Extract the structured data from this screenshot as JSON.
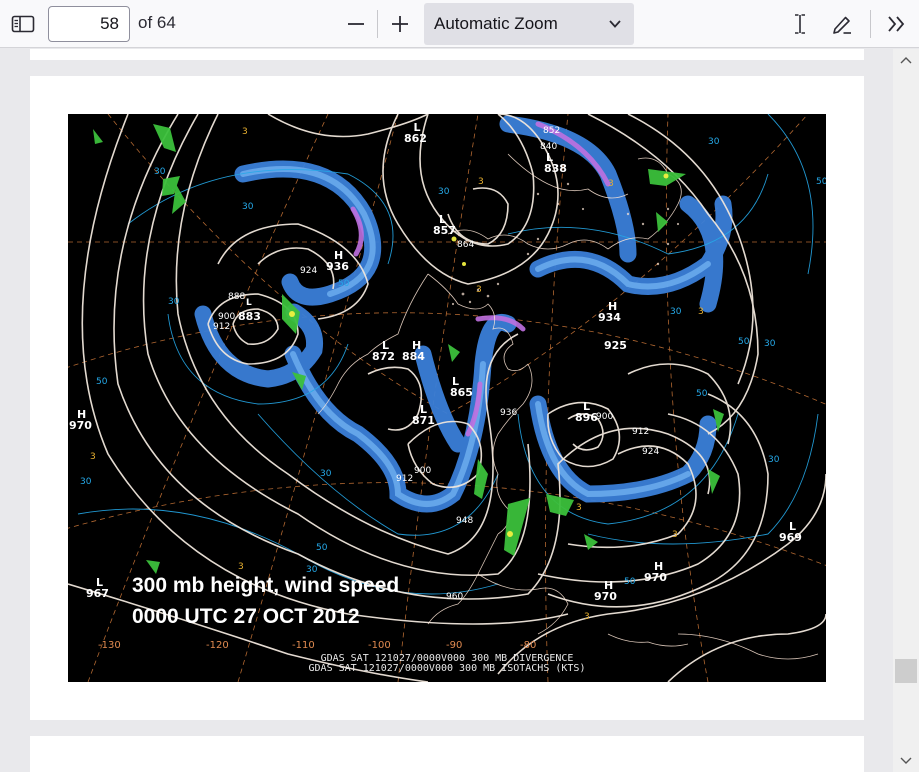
{
  "toolbar": {
    "page_number": "58",
    "page_count": "of 64",
    "zoom_label": "Automatic Zoom",
    "icons": [
      "sidebar-toggle-icon",
      "zoom-out-icon",
      "zoom-in-icon",
      "chevron-down-icon",
      "text-cursor-icon",
      "draw-pen-icon",
      "double-chevron-right-icon"
    ]
  },
  "figure": {
    "caption_line1": "300 mb height, wind speed",
    "caption_line2": "0000 UTC 27 OCT 2012",
    "footer_line1": "GDAS SAT 121027/0000V000 300 MB DIVERGENCE",
    "footer_line2": "GDAS SAT 121027/0000V000 300 MB ISOTACHS (KTS)",
    "longitudes": [
      "-130",
      "-120",
      "-110",
      "-100",
      "-90",
      "-80"
    ],
    "pressure_centers": [
      {
        "type": "L",
        "value": "862"
      },
      {
        "type": "L",
        "value": "852"
      },
      {
        "type": "L",
        "value": "840"
      },
      {
        "type": "L",
        "value": "838"
      },
      {
        "type": "L",
        "value": "857"
      },
      {
        "type": "",
        "value": "864"
      },
      {
        "type": "H",
        "value": "936"
      },
      {
        "type": "",
        "value": "924"
      },
      {
        "type": "L",
        "value": "888"
      },
      {
        "type": "",
        "value": "883"
      },
      {
        "type": "",
        "value": "900"
      },
      {
        "type": "",
        "value": "912"
      },
      {
        "type": "L",
        "value": "872"
      },
      {
        "type": "H",
        "value": "884"
      },
      {
        "type": "H",
        "value": "934"
      },
      {
        "type": "",
        "value": "925"
      },
      {
        "type": "L",
        "value": "865"
      },
      {
        "type": "L",
        "value": "871"
      },
      {
        "type": "H",
        "value": "970"
      },
      {
        "type": "L",
        "value": "896"
      },
      {
        "type": "",
        "value": "900"
      },
      {
        "type": "",
        "value": "912"
      },
      {
        "type": "",
        "value": "924"
      },
      {
        "type": "L",
        "value": "969"
      },
      {
        "type": "H",
        "value": "970"
      },
      {
        "type": "H",
        "value": "970"
      },
      {
        "type": "L",
        "value": "967"
      },
      {
        "type": "",
        "value": "960"
      },
      {
        "type": "",
        "value": "948"
      },
      {
        "type": "",
        "value": "936"
      },
      {
        "type": "",
        "value": "900"
      },
      {
        "type": "",
        "value": "912"
      }
    ],
    "isotach_labels": [
      "30",
      "50",
      "30",
      "50",
      "30",
      "50",
      "30"
    ],
    "colors": {
      "background": "#000000",
      "height_contours": "#f0e6dc",
      "isotach_fill": "#3a7fd8",
      "isotach_core": "#c070e0",
      "divergence": "#3cc03c",
      "divergence_core": "#f0f040",
      "grid": "#d07a3a",
      "isotach_lines": "#25a8e8"
    }
  }
}
